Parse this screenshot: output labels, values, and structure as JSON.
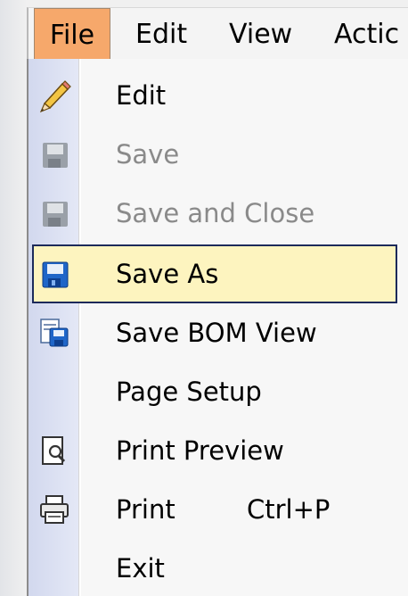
{
  "menubar": {
    "items": [
      "File",
      "Edit",
      "View",
      "Actic"
    ]
  },
  "file_menu": {
    "items": [
      {
        "label": "Edit",
        "icon": "pencil-icon",
        "enabled": true
      },
      {
        "label": "Save",
        "icon": "floppy-disk-icon",
        "enabled": false
      },
      {
        "label": "Save and Close",
        "icon": "floppy-disk-icon",
        "enabled": false
      },
      {
        "label": "Save As",
        "icon": "floppy-disk-icon",
        "enabled": true,
        "highlighted": true
      },
      {
        "label": "Save BOM View",
        "icon": "save-bom-view-icon",
        "enabled": true
      },
      {
        "label": "Page Setup",
        "icon": "",
        "enabled": true
      },
      {
        "label": "Print Preview",
        "icon": "print-preview-icon",
        "enabled": true
      },
      {
        "label": "Print",
        "icon": "printer-icon",
        "enabled": true,
        "shortcut": "Ctrl+P"
      },
      {
        "label": "Exit",
        "icon": "",
        "enabled": true
      }
    ]
  },
  "colors": {
    "menu_active": "#f6a86b",
    "hover_bg": "#fdf4bf",
    "hover_border": "#1c2a5a",
    "disabled_text": "#8a8a8a",
    "icon_strip": "#d8ddf0"
  }
}
